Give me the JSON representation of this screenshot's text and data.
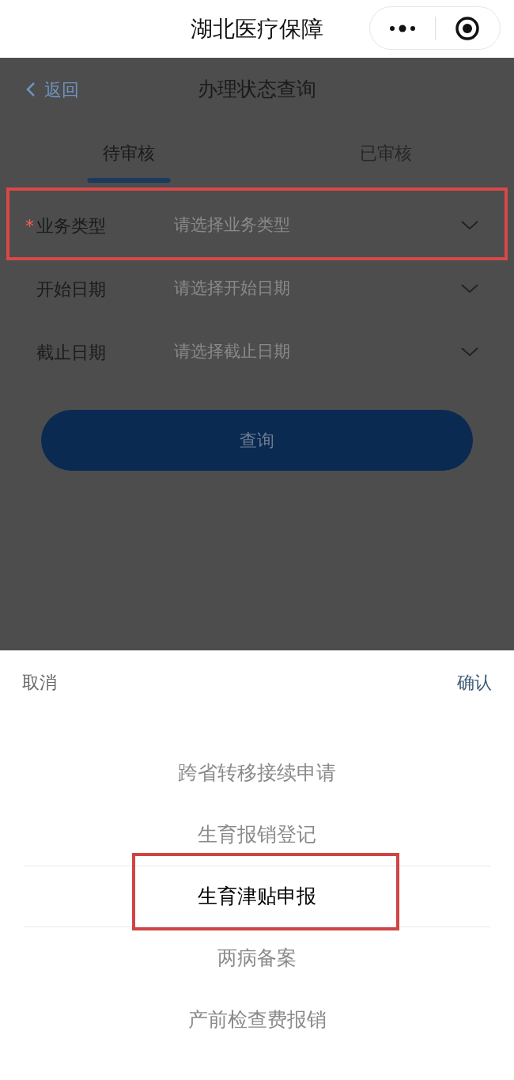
{
  "app_bar": {
    "title": "湖北医疗保障"
  },
  "nav": {
    "back": "返回",
    "title": "办理状态查询"
  },
  "tabs": [
    {
      "label": "待审核",
      "selected": true
    },
    {
      "label": "已审核",
      "selected": false
    }
  ],
  "form": {
    "fields": [
      {
        "label": "业务类型",
        "placeholder": "请选择业务类型",
        "required_mark": "*",
        "highlighted": true
      },
      {
        "label": "开始日期",
        "placeholder": "请选择开始日期",
        "highlighted": false
      },
      {
        "label": "截止日期",
        "placeholder": "请选择截止日期",
        "highlighted": false
      }
    ],
    "submit": "查询"
  },
  "picker": {
    "cancel": "取消",
    "confirm": "确认",
    "options": [
      {
        "label": "跨省转移接续申请",
        "selected": false,
        "highlighted": false
      },
      {
        "label": "生育报销登记",
        "selected": false,
        "highlighted": false
      },
      {
        "label": "生育津贴申报",
        "selected": true,
        "highlighted": true
      },
      {
        "label": "两病备案",
        "selected": false,
        "highlighted": false
      },
      {
        "label": "产前检查费报销",
        "selected": false,
        "highlighted": false
      }
    ]
  }
}
